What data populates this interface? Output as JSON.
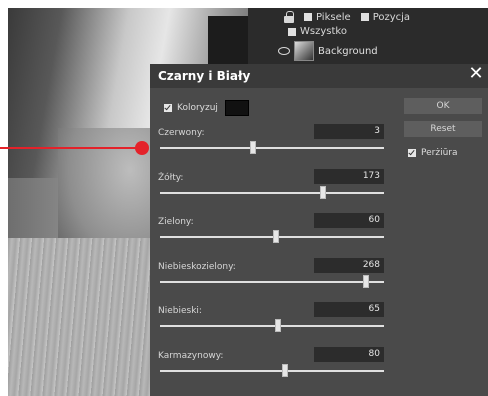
{
  "layers_panel": {
    "lock_options": [
      "Piksele",
      "Pozycja"
    ],
    "all_option": "Wszystko",
    "layer_name": "Background"
  },
  "dialog": {
    "title": "Czarny i Biały",
    "colorize_label": "Koloryzuj",
    "colorize_checked": true,
    "colorize_color": "#111111",
    "ok_label": "OK",
    "reset_label": "Reset",
    "preview_label": "Perżiūra",
    "preview_checked": true,
    "sliders": [
      {
        "label": "Czerwony:",
        "value": "3",
        "level": 0.42
      },
      {
        "label": "Żółty:",
        "value": "173",
        "level": 0.73
      },
      {
        "label": "Zielony:",
        "value": "60",
        "level": 0.52
      },
      {
        "label": "Niebieskozielony:",
        "value": "268",
        "level": 0.92
      },
      {
        "label": "Niebieski:",
        "value": "65",
        "level": 0.53
      },
      {
        "label": "Karmazynowy:",
        "value": "80",
        "level": 0.56
      }
    ]
  },
  "colors": {
    "dialog_bg": "#4a4a4a",
    "annotation_red": "#e4222a"
  }
}
